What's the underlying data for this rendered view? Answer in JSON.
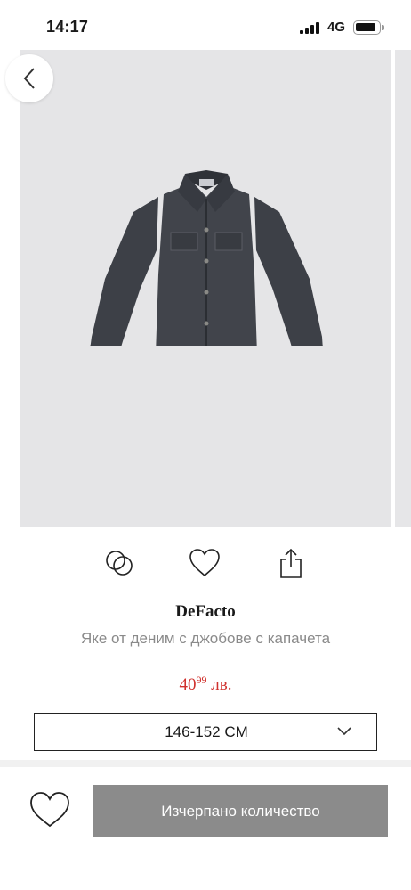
{
  "status_bar": {
    "time": "14:17",
    "network": "4G",
    "icons": [
      "signal-icon",
      "battery-icon"
    ]
  },
  "gallery": {
    "image_count": 4,
    "active_index": 0,
    "back_icon": "chevron-left-icon"
  },
  "actions": {
    "icons": [
      "compare-icon",
      "heart-icon",
      "share-icon"
    ]
  },
  "product": {
    "brand": "DeFacto",
    "name": "Яке от деним с джобове с капачета",
    "price_main": "40",
    "price_cents": "99",
    "price_currency": "лв."
  },
  "size_selector": {
    "selected": "146-152 CM",
    "icon": "chevron-down-icon"
  },
  "footer": {
    "button_label": "Изчерпано количество",
    "favorite_icon": "heart-icon"
  },
  "colors": {
    "price": "#d0312d",
    "button_bg": "#8b8b8b",
    "image_bg": "#e5e5e7"
  }
}
